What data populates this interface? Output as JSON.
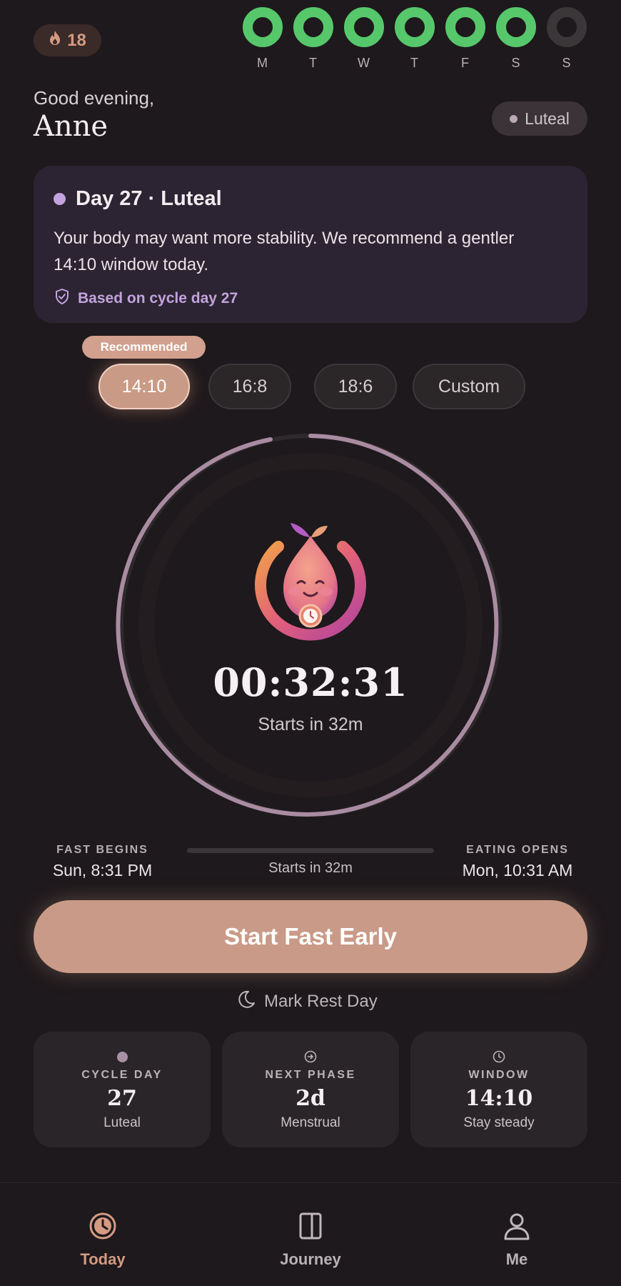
{
  "streak": {
    "count": "18",
    "icon": "flame-icon"
  },
  "week": [
    {
      "label": "M",
      "done": true
    },
    {
      "label": "T",
      "done": true
    },
    {
      "label": "W",
      "done": true
    },
    {
      "label": "T",
      "done": true
    },
    {
      "label": "F",
      "done": true
    },
    {
      "label": "S",
      "done": true
    },
    {
      "label": "S",
      "done": false
    }
  ],
  "header": {
    "greeting": "Good evening,",
    "name": "Anne",
    "phase_pill": "Luteal"
  },
  "insight": {
    "title": "Day 27 · Luteal",
    "body": "Your body may want more stability. We recommend a gentler 14:10 window today.",
    "note": "Based on cycle day 27"
  },
  "windows": {
    "recommended_badge": "Recommended",
    "options": [
      "14:10",
      "16:8",
      "18:6",
      "Custom"
    ],
    "selected": "14:10"
  },
  "timer": {
    "value": "00:32:31",
    "subtitle": "Starts in 32m"
  },
  "schedule": {
    "fast_begins_label": "FAST BEGINS",
    "fast_begins_value": "Sun, 8:31 PM",
    "progress_label": "Starts in 32m",
    "progress": 0,
    "eating_opens_label": "EATING OPENS",
    "eating_opens_value": "Mon, 10:31 AM"
  },
  "actions": {
    "start_label": "Start Fast Early",
    "rest_label": "Mark Rest Day"
  },
  "stats": [
    {
      "label": "CYCLE DAY",
      "value": "27",
      "sub": "Luteal",
      "icon": "dot-icon"
    },
    {
      "label": "NEXT PHASE",
      "value": "2d",
      "sub": "Menstrual",
      "icon": "arrow-right-circle-icon"
    },
    {
      "label": "WINDOW",
      "value": "14:10",
      "sub": "Stay steady",
      "icon": "clock-icon"
    }
  ],
  "tabs": [
    {
      "label": "Today",
      "icon": "timer-icon",
      "active": true
    },
    {
      "label": "Journey",
      "icon": "book-icon",
      "active": false
    },
    {
      "label": "Me",
      "icon": "person-icon",
      "active": false
    }
  ],
  "colors": {
    "accent": "#c99a85",
    "streak_green": "#56c86b",
    "phase_purple": "#c3a3df",
    "background": "#1e191c"
  }
}
